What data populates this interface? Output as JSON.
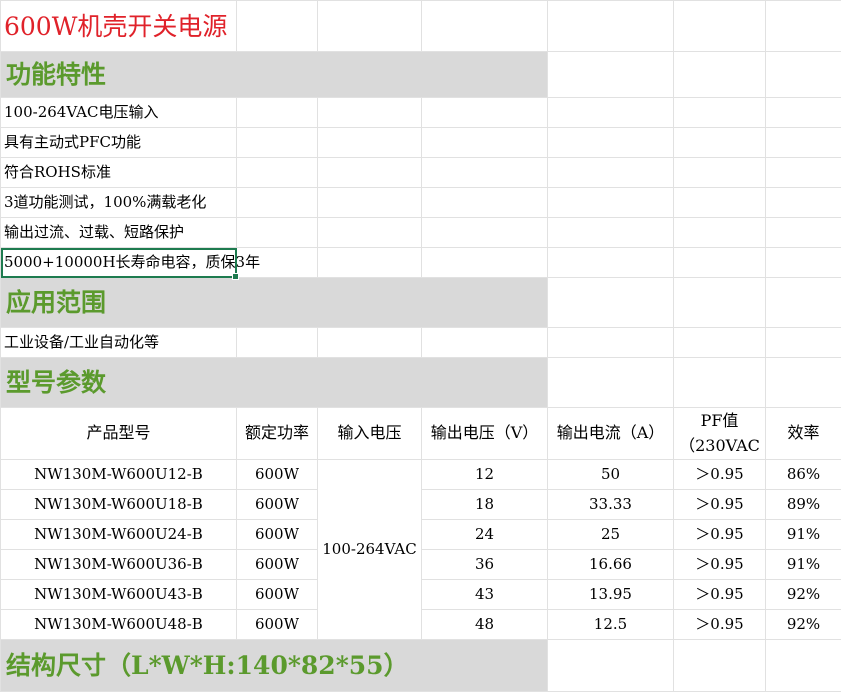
{
  "colors": {
    "title_text": "#e0222a",
    "section_text": "#5b9a2d",
    "section_fill": "#d9d9d9",
    "selection_border": "#1e7b4f",
    "grid_line": "#e1e1e1"
  },
  "title": "600W机壳开关电源",
  "sections": {
    "features": "功能特性",
    "application": "应用范围",
    "models": "型号参数",
    "dimensions": "结构尺寸（L*W*H:140*82*55）"
  },
  "features": [
    "100-264VAC电压输入",
    "具有主动式PFC功能",
    "符合ROHS标准",
    "3道功能测试，100%满载老化",
    "输出过流、过载、短路保护",
    "5000+10000H长寿命电容，质保3年"
  ],
  "application": "工业设备/工业自动化等",
  "table": {
    "headers": {
      "model": "产品型号",
      "power": "额定功率",
      "input": "输入电压",
      "out_voltage": "输出电压（V）",
      "out_current": "输出电流（A）",
      "pf_line1": "PF值",
      "pf_line2": "（230VAC",
      "efficiency": "效率"
    },
    "input_voltage": "100-264VAC",
    "rows": [
      {
        "model": "NW130M-W600U12-B",
        "power": "600W",
        "voltage": "12",
        "current": "50",
        "pf": "＞0.95",
        "eff": "86%"
      },
      {
        "model": "NW130M-W600U18-B",
        "power": "600W",
        "voltage": "18",
        "current": "33.33",
        "pf": "＞0.95",
        "eff": "89%"
      },
      {
        "model": "NW130M-W600U24-B",
        "power": "600W",
        "voltage": "24",
        "current": "25",
        "pf": "＞0.95",
        "eff": "91%"
      },
      {
        "model": "NW130M-W600U36-B",
        "power": "600W",
        "voltage": "36",
        "current": "16.66",
        "pf": "＞0.95",
        "eff": "91%"
      },
      {
        "model": "NW130M-W600U43-B",
        "power": "600W",
        "voltage": "43",
        "current": "13.95",
        "pf": "＞0.95",
        "eff": "92%"
      },
      {
        "model": "NW130M-W600U48-B",
        "power": "600W",
        "voltage": "48",
        "current": "12.5",
        "pf": "＞0.95",
        "eff": "92%"
      }
    ]
  }
}
